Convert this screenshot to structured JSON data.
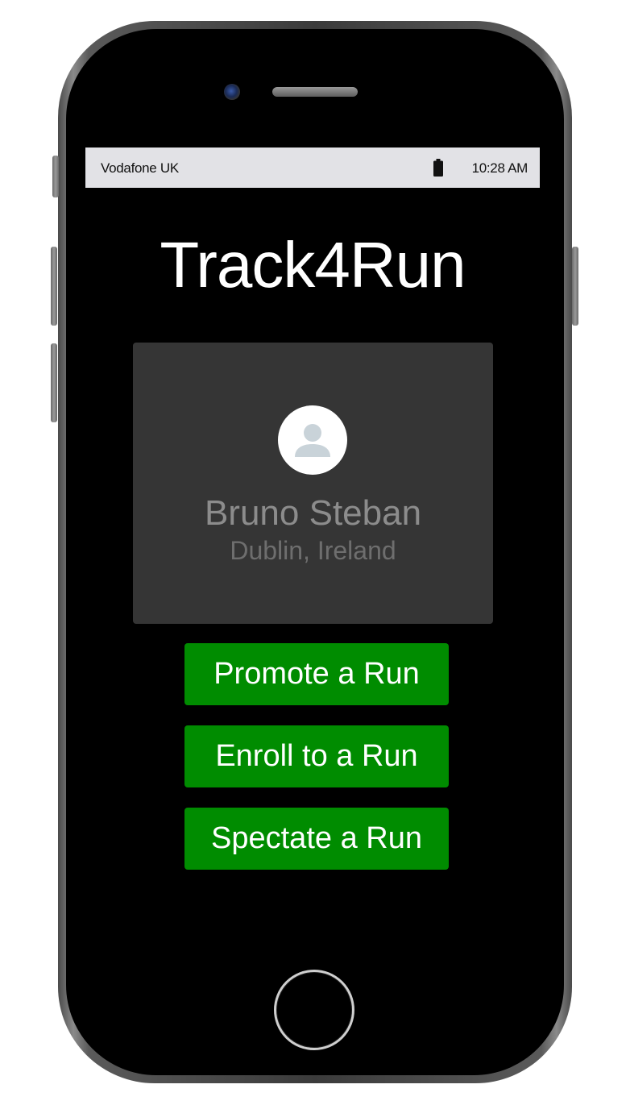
{
  "status_bar": {
    "carrier": "Vodafone UK",
    "battery_icon": "battery-full-icon",
    "time": "10:28 AM"
  },
  "app": {
    "title": "Track4Run"
  },
  "profile": {
    "avatar_icon": "person-avatar-icon",
    "name": "Bruno Steban",
    "location": "Dublin, Ireland"
  },
  "actions": {
    "promote_label": "Promote a Run",
    "enroll_label": "Enroll to a Run",
    "spectate_label": "Spectate a Run"
  },
  "colors": {
    "button_green": "#008c00",
    "card_gray": "#353535",
    "status_bar_bg": "#e2e2e6",
    "screen_bg": "#000000"
  }
}
